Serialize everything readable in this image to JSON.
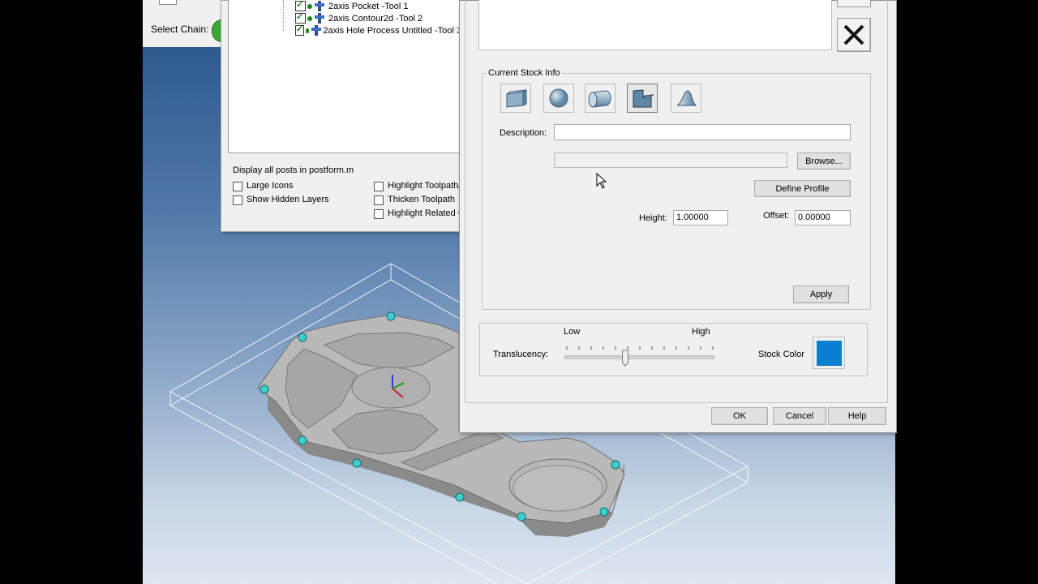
{
  "select_chain_label": "Select Chain:",
  "tree": {
    "items": [
      {
        "label": "2axis Pocket  -Tool 1"
      },
      {
        "label": "2axis Contour2d  -Tool 2"
      },
      {
        "label": "2axis Hole Process Untitled -Tool 3"
      }
    ]
  },
  "options": {
    "display_posts": "Display all posts in postform.m",
    "large_icons": "Large Icons",
    "show_hidden_layers": "Show Hidden Layers",
    "highlight_toolpath": "Highlight Toolpath/C",
    "thicken_toolpath": "Thicken Toolpath",
    "highlight_related": "Highlight Related G"
  },
  "stock": {
    "group_title": "Current Stock Info",
    "shape_icons": [
      "box-stock-icon",
      "cylinder-stock-icon",
      "rotated-cylinder-stock-icon",
      "extruded-profile-stock-icon",
      "revolved-stock-icon"
    ],
    "description_label": "Description:",
    "description_value": "",
    "file_value": "",
    "browse_label": "Browse...",
    "define_profile_label": "Define Profile",
    "height_label": "Height:",
    "height_value": "1.00000",
    "offset_label": "Offset:",
    "offset_value": "0.00000",
    "apply_label": "Apply"
  },
  "display": {
    "translucency_label": "Translucency:",
    "low_label": "Low",
    "high_label": "High",
    "translucency_level": 0.4,
    "stock_color_label": "Stock Color",
    "stock_color": "#0a7fd0"
  },
  "buttons": {
    "ok": "OK",
    "cancel": "Cancel",
    "help": "Help"
  }
}
